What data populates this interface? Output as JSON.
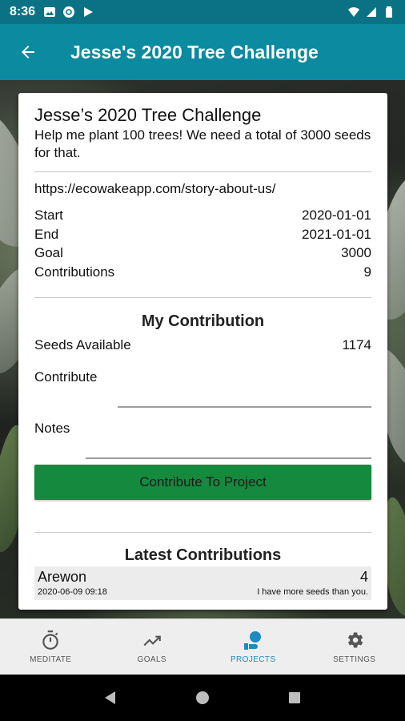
{
  "status_bar": {
    "time": "8:36",
    "icons_left": [
      "image-icon",
      "sync-icon",
      "play-icon"
    ],
    "icons_right": [
      "wifi-icon",
      "signal-icon",
      "battery-icon"
    ]
  },
  "app_bar": {
    "title": "Jesse's 2020 Tree Challenge",
    "back_icon": "arrow-left-icon"
  },
  "project": {
    "title": "Jesse’s 2020 Tree Challenge",
    "description": "Help me plant 100 trees! We need a total of 3000 seeds for that.",
    "url": "https://ecowakeapp.com/story-about-us/",
    "details": [
      {
        "label": "Start",
        "value": "2020-01-01"
      },
      {
        "label": "End",
        "value": "2021-01-01"
      },
      {
        "label": "Goal",
        "value": "3000"
      },
      {
        "label": "Contributions",
        "value": "9"
      }
    ]
  },
  "my_contribution": {
    "title": "My Contribution",
    "seeds_label": "Seeds Available",
    "seeds_value": "1174",
    "contribute_label": "Contribute",
    "contribute_value": "",
    "notes_label": "Notes",
    "notes_value": "",
    "button_label": "Contribute To Project"
  },
  "latest": {
    "title": "Latest Contributions",
    "items": [
      {
        "name": "Arewon",
        "amount": "4",
        "date": "2020-06-09 09:18",
        "note": "I have more seeds than you."
      }
    ]
  },
  "bottom_nav": {
    "items": [
      {
        "label": "MEDITATE",
        "icon": "stopwatch-icon",
        "active": false
      },
      {
        "label": "GOALS",
        "icon": "trending-up-icon",
        "active": false
      },
      {
        "label": "PROJECTS",
        "icon": "projects-icon",
        "active": true
      },
      {
        "label": "SETTINGS",
        "icon": "gear-icon",
        "active": false
      }
    ]
  },
  "colors": {
    "status_bar": "#0b7285",
    "app_bar": "#0b8aa0",
    "button": "#158a3e",
    "nav_active": "#1b8bc0"
  }
}
